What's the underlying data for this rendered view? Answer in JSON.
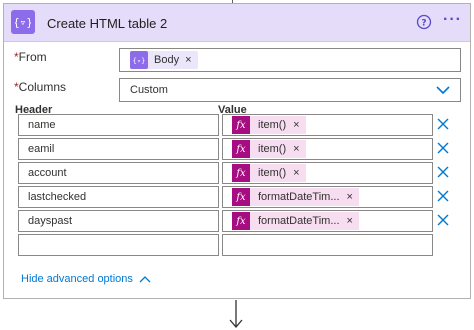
{
  "action": {
    "title": "Create HTML table 2",
    "header_icon": "table-curly-icon",
    "help_icon": "question-circle-icon",
    "more_label": "···"
  },
  "from": {
    "label": "From",
    "required_mark": "*",
    "token": "Body",
    "token_remove": "×"
  },
  "columns": {
    "label": "Columns",
    "required_mark": "*",
    "value": "Custom"
  },
  "table": {
    "header_label": "Header",
    "value_label": "Value",
    "rows": [
      {
        "header": "name",
        "value": "item()"
      },
      {
        "header": "eamil",
        "value": "item()"
      },
      {
        "header": "account",
        "value": "item()"
      },
      {
        "header": "lastchecked",
        "value": "formatDateTim..."
      },
      {
        "header": "dayspast",
        "value": "formatDateTim..."
      },
      {
        "header": "",
        "value": ""
      }
    ],
    "token_remove": "×",
    "fx_label": "fx"
  },
  "advanced": {
    "label": "Hide advanced options"
  },
  "colors": {
    "header_bg": "#e4dcf8",
    "accent_purple": "#8c6cea",
    "fx_magenta": "#a50d80",
    "fx_token_bg": "#f6ddf0",
    "link_blue": "#0078d4"
  }
}
